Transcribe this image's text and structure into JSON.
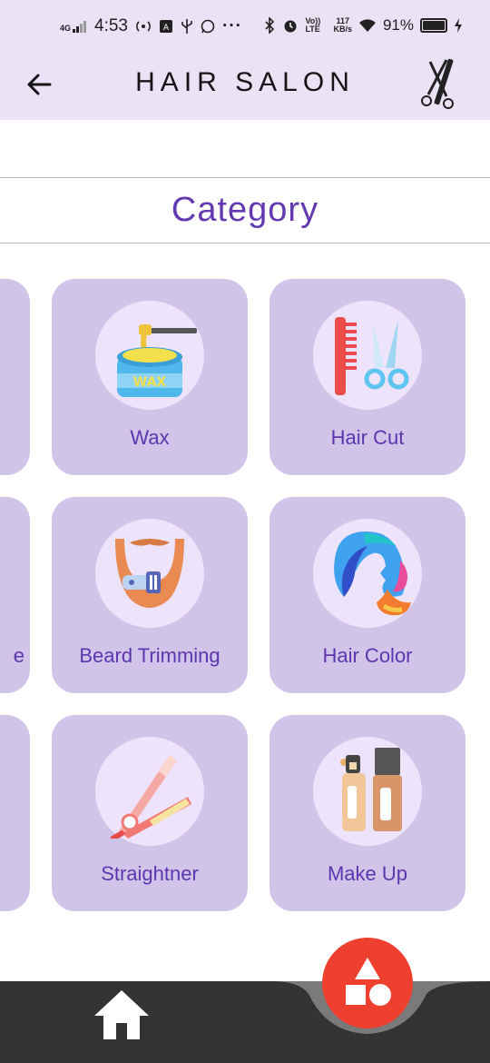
{
  "status_bar": {
    "network": "4G",
    "time": "4:53",
    "volte": "Vo)) LTE",
    "speed_value": "117",
    "speed_unit": "KB/s",
    "battery": "91%"
  },
  "app_bar": {
    "title": "HAIR SALON",
    "back_icon": "arrow-left-icon",
    "right_icon": "scissors-comb-icon"
  },
  "section": {
    "title": "Category"
  },
  "categories": [
    {
      "label": "Wax",
      "icon": "wax-icon"
    },
    {
      "label": "Hair Cut",
      "icon": "haircut-icon"
    },
    {
      "label": "Beard Trimming",
      "icon": "beard-trimmer-icon"
    },
    {
      "label": "Hair Color",
      "icon": "hair-color-icon"
    },
    {
      "label": "Straightner",
      "icon": "straightener-icon"
    },
    {
      "label": "Make Up",
      "icon": "makeup-icon"
    }
  ],
  "partial_left_cards": [
    {
      "clipped_text": "e"
    }
  ],
  "bottom_nav": {
    "home_icon": "home-icon",
    "fab_icon": "shapes-icon"
  },
  "colors": {
    "app_bar_bg": "#ebe2f6",
    "card_bg": "#d1c4e9",
    "accent_purple": "#5d35b0",
    "fab_red": "#ef3f2f",
    "bottom_nav_bg": "#333333"
  }
}
